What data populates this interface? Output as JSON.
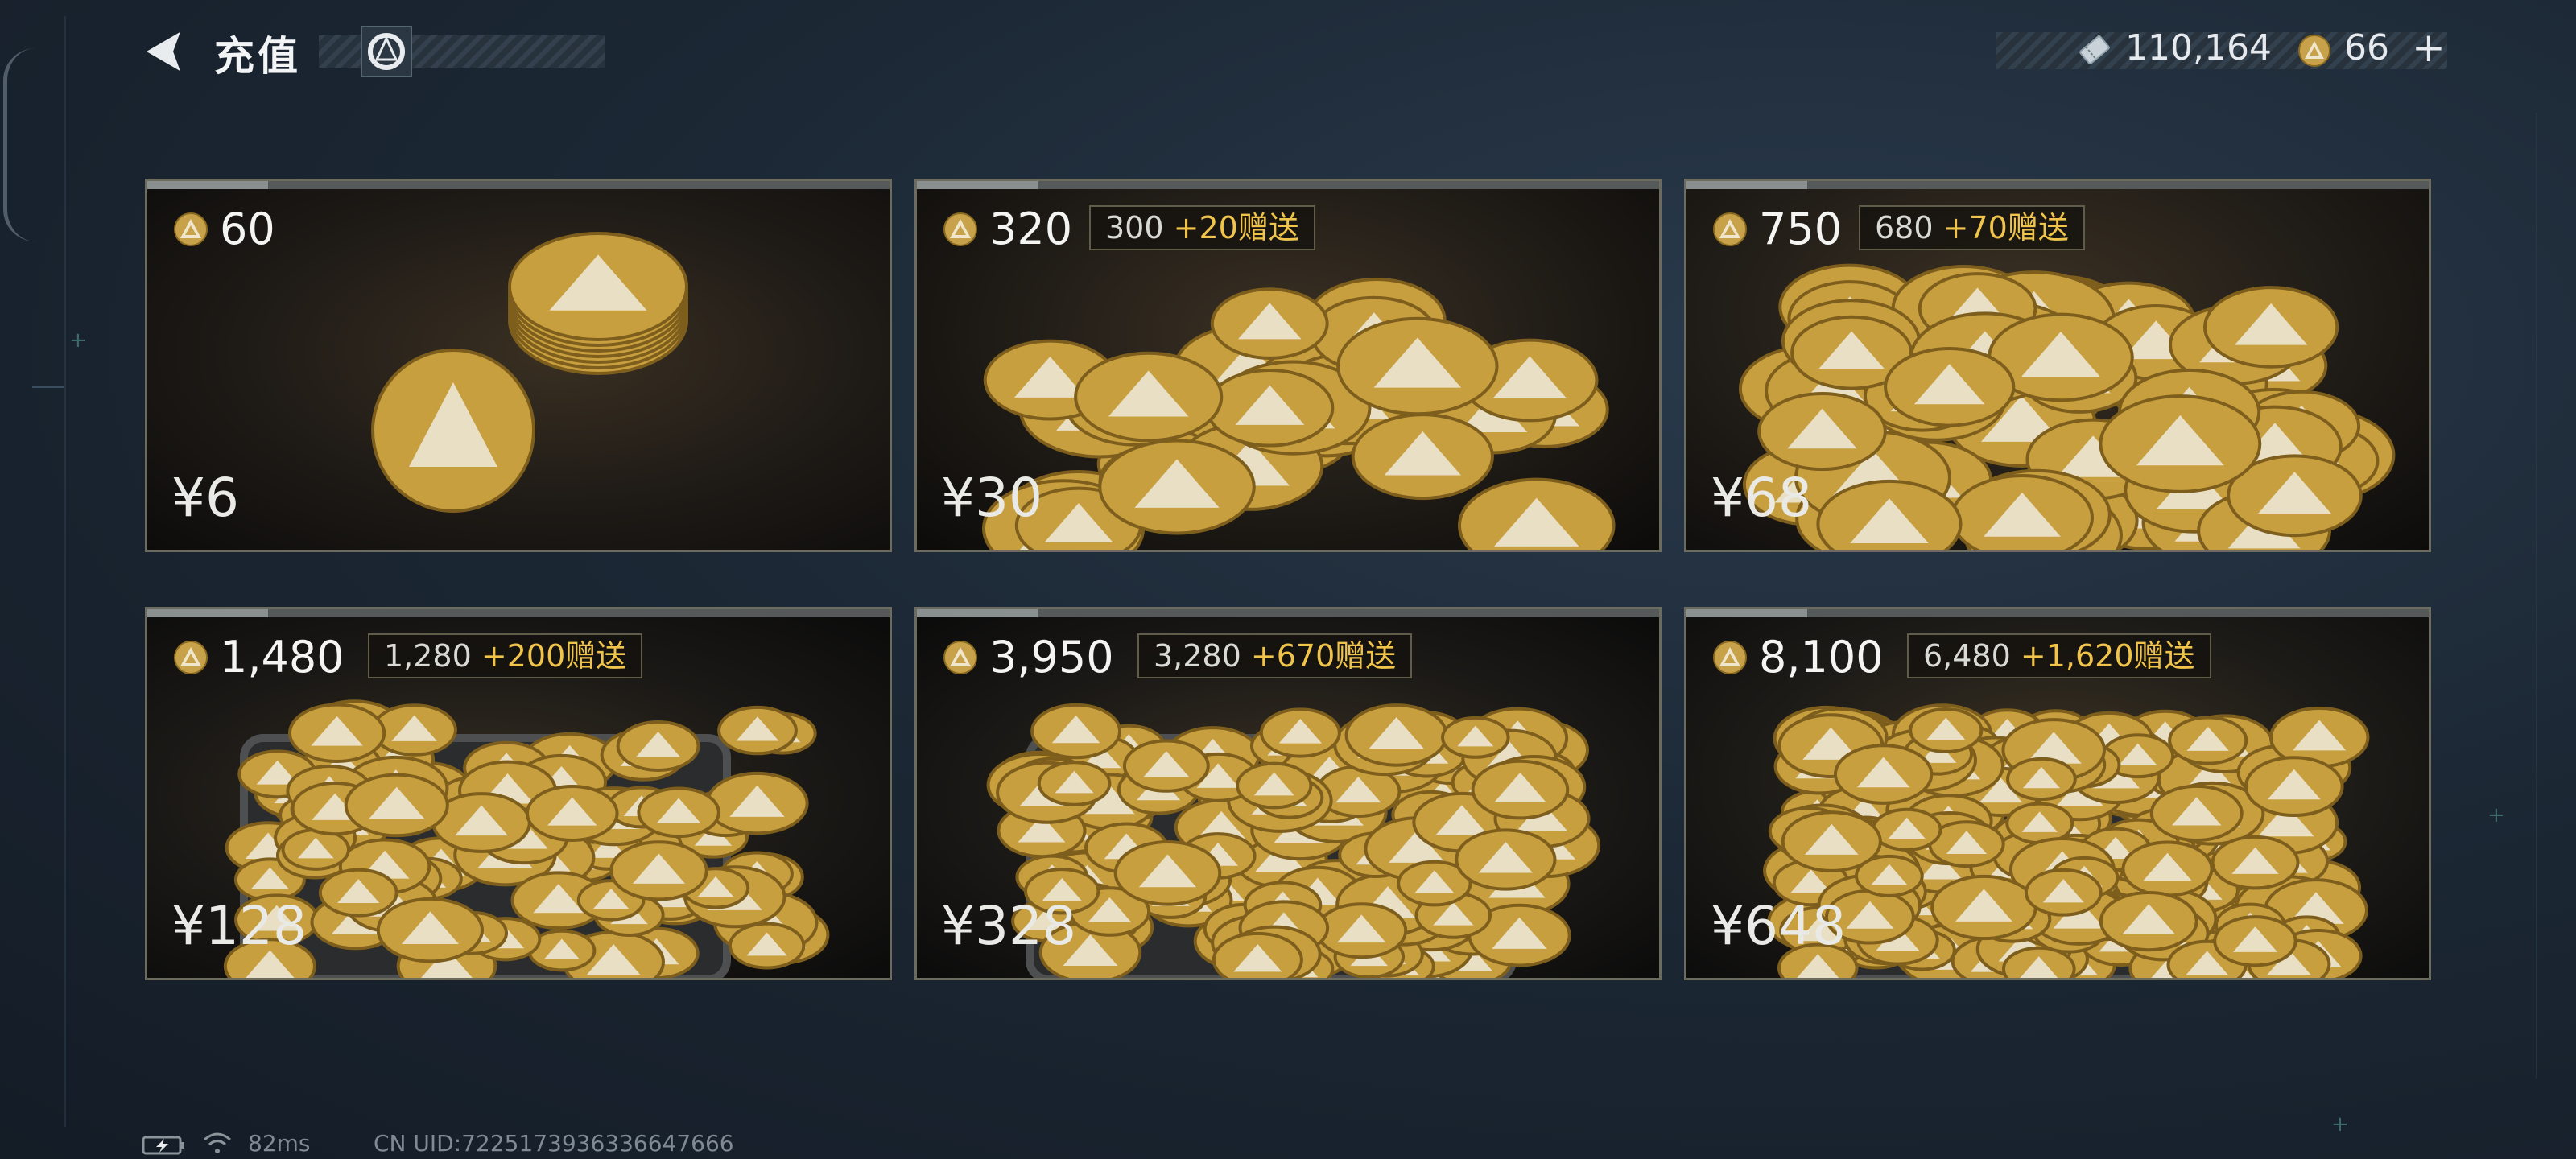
{
  "header": {
    "title": "充值",
    "back_icon": "back-arrow-icon",
    "brand_icon": "game-logo-icon"
  },
  "currencies": {
    "primary": {
      "icon": "voucher-icon",
      "value": "110,164"
    },
    "coins": {
      "icon": "coin-icon",
      "value": "66",
      "add_label": "+"
    }
  },
  "packs": [
    {
      "amount": "60",
      "bonus_base": "",
      "bonus_extra": "",
      "price": "¥6",
      "coins_shown": 8
    },
    {
      "amount": "320",
      "bonus_base": "300",
      "bonus_extra": "+20赠送",
      "price": "¥30",
      "coins_shown": 30
    },
    {
      "amount": "750",
      "bonus_base": "680",
      "bonus_extra": "+70赠送",
      "price": "¥68",
      "coins_shown": 60
    },
    {
      "amount": "1,480",
      "bonus_base": "1,280",
      "bonus_extra": "+200赠送",
      "price": "¥128",
      "coins_shown": 80
    },
    {
      "amount": "3,950",
      "bonus_base": "3,280",
      "bonus_extra": "+670赠送",
      "price": "¥328",
      "coins_shown": 120
    },
    {
      "amount": "8,100",
      "bonus_base": "6,480",
      "bonus_extra": "+1,620赠送",
      "price": "¥648",
      "coins_shown": 200
    }
  ],
  "status": {
    "ping": "82ms",
    "uid": "CN UID:7225173936336647666"
  },
  "colors": {
    "accent_gold": "#f0c44a",
    "card_border": "#6b6c5f",
    "background": "#1c2835"
  }
}
